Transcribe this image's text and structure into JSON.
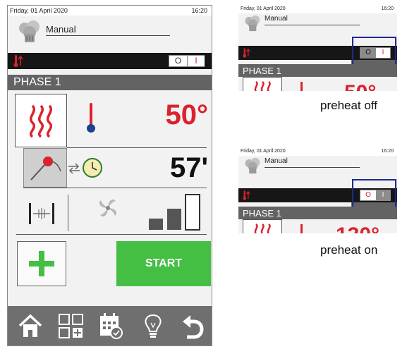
{
  "main_screen": {
    "status_bar": {
      "date": "Friday, 01 April 2020",
      "time": "16:20"
    },
    "program": {
      "name": "Manual",
      "icon": "chef-hat-icon"
    },
    "preheat": {
      "toggle_off_label": "O",
      "toggle_on_label": "I",
      "state": "off"
    },
    "phase": {
      "label": "PHASE 1"
    },
    "cooking_mode": {
      "icon": "heat-waves-icon",
      "selected": true
    },
    "temperature": {
      "value": "50°",
      "icon": "thermometer-icon"
    },
    "probe": {
      "icon": "core-probe-icon",
      "swap_icon": "swap-arrows-icon"
    },
    "time": {
      "value": "57'",
      "icon": "clock-icon"
    },
    "bottom_options": {
      "icons": [
        "damper-icon",
        "fan-icon",
        "fan-speed-bars-icon"
      ]
    },
    "add_button": {
      "icon": "plus-icon"
    },
    "start_button": {
      "label": "START"
    },
    "bottom_nav": {
      "icons": [
        "home-icon",
        "grid-add-icon",
        "calendar-check-icon",
        "lightbulb-icon",
        "back-arrow-icon"
      ]
    }
  },
  "previews": [
    {
      "status_bar": {
        "date": "Friday, 01 April 2020",
        "time": "16:20"
      },
      "program_name": "Manual",
      "toggle_off_label": "O",
      "toggle_on_label": "I",
      "preheat_state": "off",
      "phase_label": "PHASE 1",
      "temperature_partial": "50°",
      "caption": "preheat off"
    },
    {
      "status_bar": {
        "date": "Friday, 01 April 2020",
        "time": "16:20"
      },
      "program_name": "Manual",
      "toggle_off_label": "O",
      "toggle_on_label": "I",
      "preheat_state": "on",
      "phase_label": "PHASE 1",
      "temperature_partial": "130°",
      "caption": "preheat on"
    }
  ],
  "colors": {
    "accent_red": "#d9232d",
    "start_green": "#44bf44",
    "dark_bar": "#161616",
    "phase_gray": "#636363",
    "highlight_blue": "#1d2a8a"
  }
}
